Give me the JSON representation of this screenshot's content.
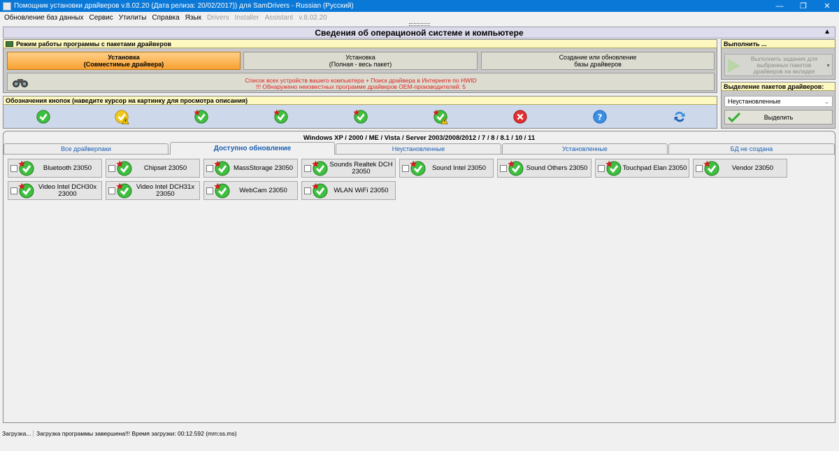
{
  "window": {
    "title": "Помощник установки драйверов v.8.02.20 (Дата релиза: 20/02/2017)) для SamDrivers - Russian (Русский)",
    "minimize": "—",
    "maximize": "❐",
    "close": "✕"
  },
  "menu": {
    "items": [
      "Обновление баз данных",
      "Сервис",
      "Утилиты",
      "Справка",
      "Язык"
    ],
    "dim_items": [
      "Drivers",
      "Installer",
      "Assistant",
      "v.8.02.20"
    ]
  },
  "system_header": {
    "title": "Сведения об операционой системе и компьютере",
    "collapse_glyph": "▲"
  },
  "mode_panel": {
    "title": "Режим работы программы с пакетами драйверов",
    "buttons": [
      {
        "line1": "Установка",
        "line2": "(Совместимые драйвера)",
        "active": true
      },
      {
        "line1": "Установка",
        "line2": "(Полная - весь пакет)",
        "active": false
      },
      {
        "line1": "Создание или обновление",
        "line2": "базы драйверов",
        "active": false
      }
    ],
    "hwid_line1": "Список всех устройств вашего компьютера + Поиск драйвера в Интернете по HWID",
    "hwid_line2": "!!! Обнаружено неизвестных программе драйверов OEM-производителей: 5"
  },
  "legend_panel": {
    "title": "Обозначения кнопок (наведите курсор на картинку для просмотра описания)",
    "icons": [
      "check-icon",
      "check-warning-icon",
      "check-new-icon",
      "check-star-icon",
      "check-new-icon",
      "check-star-warning-icon",
      "error-icon",
      "help-icon",
      "refresh-icon"
    ]
  },
  "run_panel": {
    "title": "Выполнить ...",
    "button_line1": "Выполнить задание для",
    "button_line2": "выбранных пакетов",
    "button_line3": "драйверов на вкладке"
  },
  "select_panel": {
    "title": "Выделение пакетов драйверов:",
    "dropdown_value": "Неустановленные",
    "select_button": "Выделить"
  },
  "os_box": {
    "label": "Windows XP / 2000 / ME / Vista / Server 2003/2008/2012 / 7 / 8 / 8.1 / 10 / 11",
    "tabs": [
      "Все драйверпаки",
      "Доступно обновление",
      "Неустановленные",
      "Установленные",
      "БД не создана"
    ],
    "active_tab": 1,
    "drivers": [
      "Bluetooth 23050",
      "Chipset 23050",
      "MassStorage 23050",
      "Sounds Realtek DCH 23050",
      "Sound Intel 23050",
      "Sound Others 23050",
      "Touchpad Elan 23050",
      "Vendor 23050",
      "Video Intel DCH30x 23000",
      "Video Intel DCH31x 23050",
      "WebCam 23050",
      "WLAN WiFi 23050"
    ]
  },
  "status": {
    "left": "Загрузка...",
    "message": "Загрузка программы завершена!!! Время загрузки: 00:12.592 (mm:ss.ms)"
  },
  "colors": {
    "titlebar": "#0a78d7",
    "active_mode": "#f8a030",
    "hwid_text": "#e02020",
    "tab_text": "#1a5fb4",
    "check_green": "#2fae2f"
  }
}
